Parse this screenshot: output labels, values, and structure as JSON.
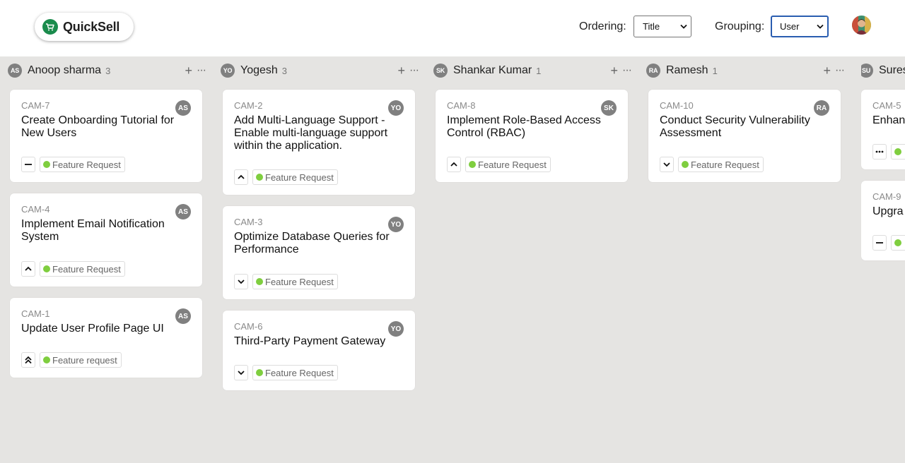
{
  "app": {
    "brand": "QuickSell"
  },
  "controls": {
    "ordering_label": "Ordering:",
    "ordering_value": "Title",
    "grouping_label": "Grouping:",
    "grouping_value": "User"
  },
  "columns": [
    {
      "initials": "AS",
      "name": "Anoop sharma",
      "count": "3",
      "cards": [
        {
          "id": "CAM-7",
          "initials": "AS",
          "title": "Create Onboarding Tutorial for New Users",
          "priority": "no-priority-icon",
          "tag": "Feature Request"
        },
        {
          "id": "CAM-4",
          "initials": "AS",
          "title": "Implement Email Notification System",
          "priority": "chevron-up-icon",
          "tag": "Feature Request"
        },
        {
          "id": "CAM-1",
          "initials": "AS",
          "title": "Update User Profile Page UI",
          "priority": "double-chevron-up-icon",
          "tag": "Feature request"
        }
      ]
    },
    {
      "initials": "YO",
      "name": "Yogesh",
      "count": "3",
      "cards": [
        {
          "id": "CAM-2",
          "initials": "YO",
          "title": "Add Multi-Language Support - Enable multi-language support within the application.",
          "priority": "chevron-up-icon",
          "tag": "Feature Request"
        },
        {
          "id": "CAM-3",
          "initials": "YO",
          "title": "Optimize Database Queries for Performance",
          "priority": "chevron-down-icon",
          "tag": "Feature Request"
        },
        {
          "id": "CAM-6",
          "initials": "YO",
          "title": "Third-Party Payment Gateway",
          "priority": "chevron-down-icon",
          "tag": "Feature Request"
        }
      ]
    },
    {
      "initials": "SK",
      "name": "Shankar Kumar",
      "count": "1",
      "cards": [
        {
          "id": "CAM-8",
          "initials": "SK",
          "title": "Implement Role-Based Access Control (RBAC)",
          "priority": "chevron-up-icon",
          "tag": "Feature Request"
        }
      ]
    },
    {
      "initials": "RA",
      "name": "Ramesh",
      "count": "1",
      "cards": [
        {
          "id": "CAM-10",
          "initials": "RA",
          "title": "Conduct Security Vulnerability Assessment",
          "priority": "chevron-down-icon",
          "tag": "Feature Request"
        }
      ]
    },
    {
      "initials": "SU",
      "name": "Sures",
      "cards": [
        {
          "id": "CAM-5",
          "title": "Enhan",
          "priority": "ellipsis-icon"
        },
        {
          "id": "CAM-9",
          "title": "Upgra",
          "priority": "no-priority-icon"
        }
      ]
    }
  ],
  "colors": {
    "tag_dot": "#7fce3f",
    "avatar_bg": "#808080",
    "board_bg": "#e5e4e2",
    "focus_border": "#2a5db0"
  }
}
